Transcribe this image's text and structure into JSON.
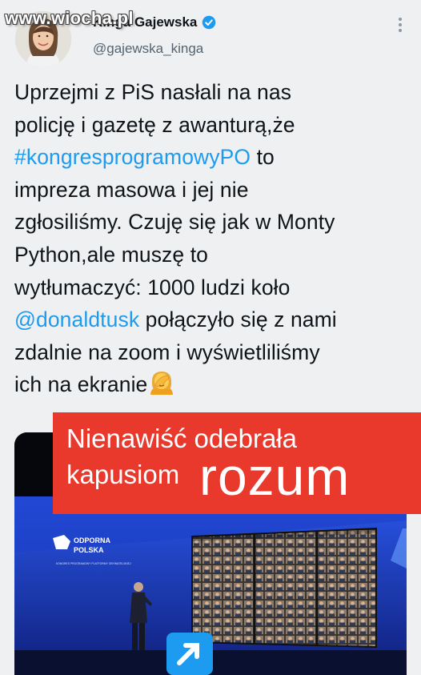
{
  "watermark": "www.wiocha.pl",
  "author": {
    "name": "Kinga Gajewska",
    "handle": "@gajewska_kinga"
  },
  "tweet": {
    "line1": "Uprzejmi z PiS nasłali na nas",
    "line2": "policję i gazetę z awanturą,że",
    "line3_hashtag": "#kongresprogramowyPO",
    "line3_rest": " to",
    "line4": "impreza masowa i jej nie",
    "line5": "zgłosiliśmy. Czuję się jak w Monty",
    "line6": "Python,ale muszę to",
    "line7": "wytłumaczyć: 1000 ludzi koło",
    "line8_mention": "@donaldtusk",
    "line8_rest": " połączyło się z nami",
    "line9": "zdalnie na zoom i wyświetliliśmy",
    "line10": "ich na ekranie",
    "emoji": "face-palm-emoji"
  },
  "media": {
    "logo_line1": "ODPORNA",
    "logo_line2": "POLSKA",
    "logo_sub": "KONGRES PROGRAMOWY PLATFORMY OBYWATELSKIEJ"
  },
  "banner": {
    "line1": "Nienawiść odebrała",
    "line2": "kapusiom",
    "big": "rozum"
  },
  "colors": {
    "link": "#1d9bf0",
    "banner": "#e8392c",
    "stage_blue": "#1a3ec0"
  }
}
